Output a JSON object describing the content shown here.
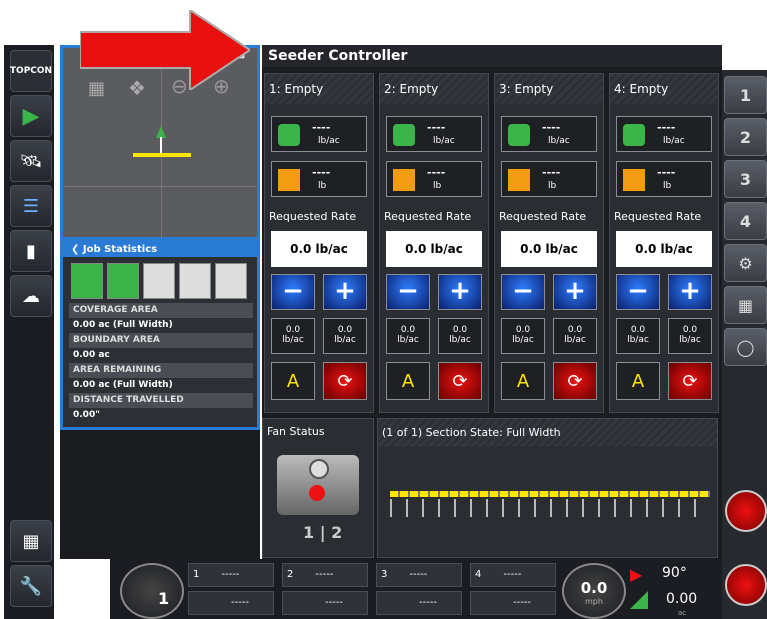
{
  "title": "Seeder Controller",
  "left_toolbar": [
    "topcon-logo-icon",
    "play-icon",
    "satellite-icon",
    "layers-icon",
    "device-icon",
    "cloud-icon",
    "bin-icon",
    "wrench-icon"
  ],
  "job_stats": {
    "header": "Job Statistics",
    "rows": [
      {
        "label": "COVERAGE AREA",
        "value": "0.00 ac (Full Width)"
      },
      {
        "label": "BOUNDARY AREA",
        "value": "0.00 ac"
      },
      {
        "label": "AREA REMAINING",
        "value": "0.00 ac (Full Width)"
      },
      {
        "label": "DISTANCE TRAVELLED",
        "value": "0.00\""
      }
    ]
  },
  "columns": [
    {
      "name": "1: Empty",
      "top_value": "----",
      "top_unit": "lb/ac",
      "mid_value": "----",
      "mid_unit": "lb",
      "req_label": "Requested Rate",
      "req_value": "0.0 lb/ac",
      "left_small": "0.0",
      "left_small_unit": "lb/ac",
      "right_small": "0.0",
      "right_small_unit": "lb/ac"
    },
    {
      "name": "2: Empty",
      "top_value": "----",
      "top_unit": "lb/ac",
      "mid_value": "----",
      "mid_unit": "lb",
      "req_label": "Requested Rate",
      "req_value": "0.0 lb/ac",
      "left_small": "0.0",
      "left_small_unit": "lb/ac",
      "right_small": "0.0",
      "right_small_unit": "lb/ac"
    },
    {
      "name": "3: Empty",
      "top_value": "----",
      "top_unit": "lb/ac",
      "mid_value": "----",
      "mid_unit": "lb",
      "req_label": "Requested Rate",
      "req_value": "0.0 lb/ac",
      "left_small": "0.0",
      "left_small_unit": "lb/ac",
      "right_small": "0.0",
      "right_small_unit": "lb/ac"
    },
    {
      "name": "4: Empty",
      "top_value": "----",
      "top_unit": "lb/ac",
      "mid_value": "----",
      "mid_unit": "lb",
      "req_label": "Requested Rate",
      "req_value": "0.0 lb/ac",
      "left_small": "0.0",
      "left_small_unit": "lb/ac",
      "right_small": "0.0",
      "right_small_unit": "lb/ac"
    }
  ],
  "minus_label": "−",
  "plus_label": "+",
  "fan_status": "Fan Status",
  "section_state": "(1 of 1) Section State: Full Width",
  "fan_sections": [
    "1",
    "2"
  ],
  "right_tabs": [
    "1",
    "2",
    "3",
    "4"
  ],
  "bottom": {
    "channels": [
      "1",
      "2",
      "3",
      "4"
    ],
    "placeholder": "-----",
    "speed": "0.0",
    "speed_unit": "mph",
    "heading": "90°",
    "area": "0.00",
    "area_unit": "ac",
    "gauge_number": "1"
  },
  "colors": {
    "accent": "#2a7bd6",
    "arrow": "#e8110f",
    "green": "#3bb54a",
    "red": "#c8102e"
  }
}
